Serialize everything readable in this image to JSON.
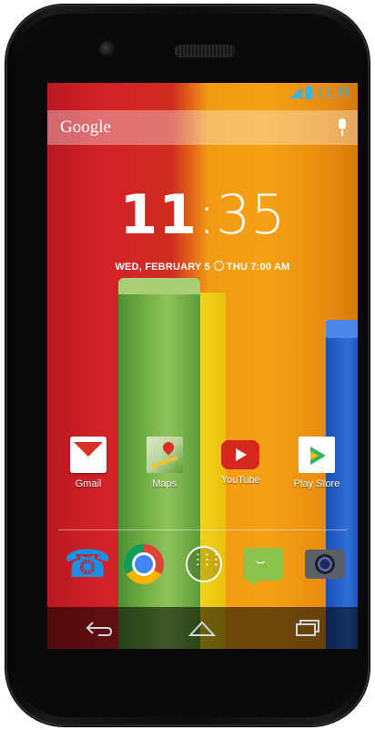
{
  "status_bar": {
    "time": "11:35"
  },
  "search": {
    "brand": "Google"
  },
  "clock": {
    "hours": "11",
    "separator": ":",
    "minutes": "35"
  },
  "date_line": {
    "date": "WED, FEBRUARY 5",
    "alarm": "THU 7:00 AM"
  },
  "apps": [
    {
      "label": "Gmail",
      "icon": "gmail-icon"
    },
    {
      "label": "Maps",
      "icon": "maps-icon"
    },
    {
      "label": "YouTube",
      "icon": "youtube-icon"
    },
    {
      "label": "Play Store",
      "icon": "play-store-icon"
    }
  ],
  "dock": [
    "phone-icon",
    "chrome-icon",
    "app-drawer-icon",
    "messaging-icon",
    "camera-icon"
  ],
  "nav": [
    "back-icon",
    "home-icon",
    "recents-icon"
  ],
  "colors": {
    "clock_accent": "#33b5e5",
    "wallpaper_red": "#d42128",
    "wallpaper_orange": "#f29a12"
  }
}
